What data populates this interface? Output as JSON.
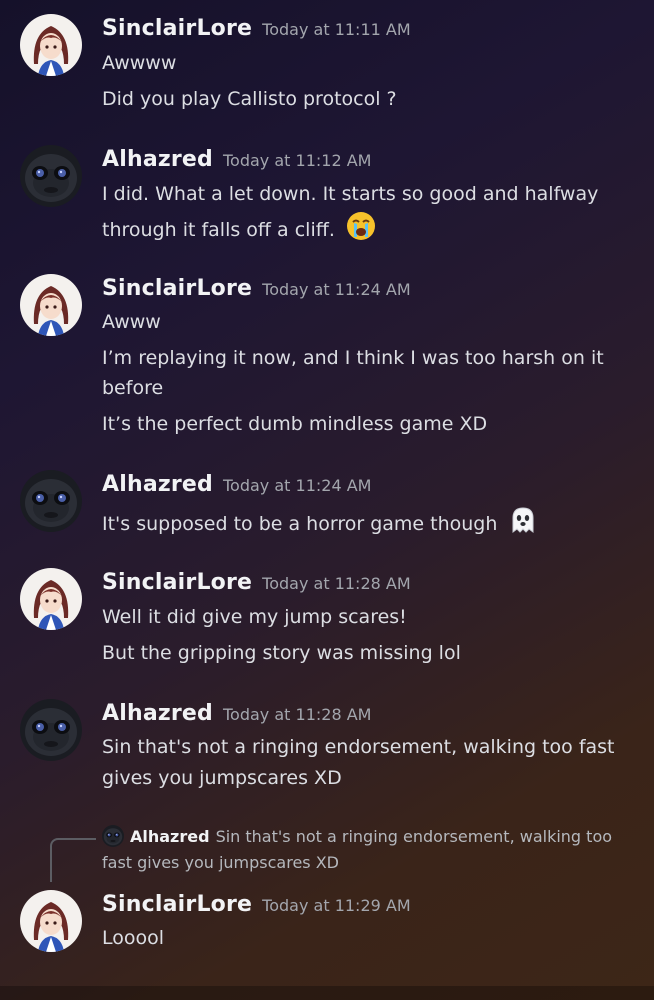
{
  "messages": [
    {
      "user": "SinclairLore",
      "time": "Today at 11:11 AM",
      "avatar_icon": "anime-girl-avatar",
      "lines": [
        "Awwww",
        "Did you play Callisto protocol ?"
      ]
    },
    {
      "user": "Alhazred",
      "time": "Today at 11:12 AM",
      "avatar_icon": "dark-face-avatar",
      "lines": [
        "I did. What a let down. It starts so good and halfway",
        "through it falls off a cliff."
      ],
      "emoji": "crying-face-emoji"
    },
    {
      "user": "SinclairLore",
      "time": "Today at 11:24 AM",
      "avatar_icon": "anime-girl-avatar",
      "lines": [
        "Awww",
        "I’m replaying it now, and I think I was too harsh on it",
        "before",
        "It’s the perfect dumb mindless game XD"
      ]
    },
    {
      "user": "Alhazred",
      "time": "Today at 11:24 AM",
      "avatar_icon": "dark-face-avatar",
      "lines": [
        "It's supposed to be a horror game though"
      ],
      "emoji": "ghost-emoji"
    },
    {
      "user": "SinclairLore",
      "time": "Today at 11:28 AM",
      "avatar_icon": "anime-girl-avatar",
      "lines": [
        "Well it did give my jump scares!",
        "But the gripping story was missing lol"
      ]
    },
    {
      "user": "Alhazred",
      "time": "Today at 11:28 AM",
      "avatar_icon": "dark-face-avatar",
      "lines": [
        "Sin that's not a ringing endorsement, walking too fast",
        "gives you jumpscares XD"
      ]
    },
    {
      "user": "SinclairLore",
      "time": "Today at 11:29 AM",
      "avatar_icon": "anime-girl-avatar",
      "lines": [
        "Looool"
      ]
    }
  ],
  "reply": {
    "user": "Alhazred",
    "text_1": "Sin that's not a ringing endorsement, walking too",
    "text_2": "fast gives you jumpscares XD"
  },
  "colors": {
    "username": "#f2f3f5",
    "timestamp": "#a3a6ad",
    "text": "#dcdee3"
  }
}
